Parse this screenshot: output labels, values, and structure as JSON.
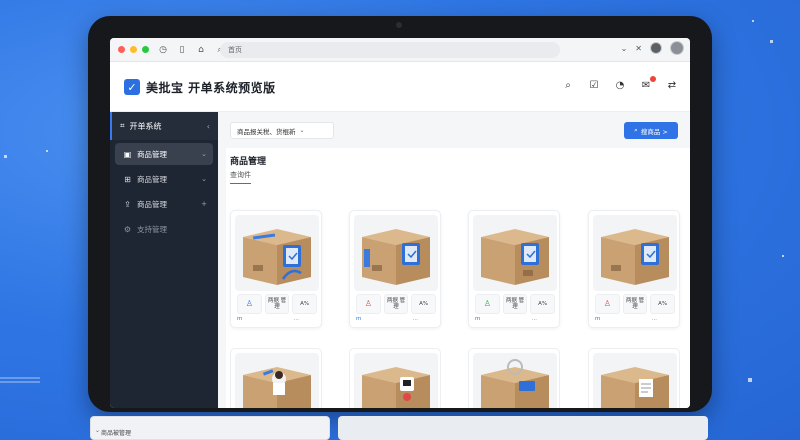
{
  "browser": {
    "address": "首页"
  },
  "app": {
    "title": "美批宝 开单系统预览版"
  },
  "sidebar": {
    "header": "开单系统",
    "items": [
      {
        "label": "商品管理",
        "active": true
      },
      {
        "label": "商品管理",
        "active": false
      },
      {
        "label": "商品管理",
        "active": false
      },
      {
        "label": "支持管理",
        "active": false
      }
    ]
  },
  "toolbar": {
    "filter_label": "商品报关税、货棍新",
    "search_label": "搜商品 >"
  },
  "main": {
    "section_title": "商品管理",
    "sub_tab": "查询件"
  },
  "cards": [
    {
      "meta1": "两据 管理",
      "meta2": "A%",
      "tag": "m",
      "more": "…"
    },
    {
      "meta1": "两据 管理",
      "meta2": "A%",
      "tag": "m",
      "more": "…"
    },
    {
      "meta1": "两据 管理",
      "meta2": "A%",
      "tag": "m",
      "more": "…"
    },
    {
      "meta1": "两据 管理",
      "meta2": "A%",
      "tag": "m",
      "more": "…"
    }
  ],
  "bottom_peek": {
    "label": "商品被管理"
  },
  "colors": {
    "background": "#2f76e4",
    "sidebar": "#1f2633",
    "accent": "#2f73e6",
    "box": "#c9a173"
  }
}
